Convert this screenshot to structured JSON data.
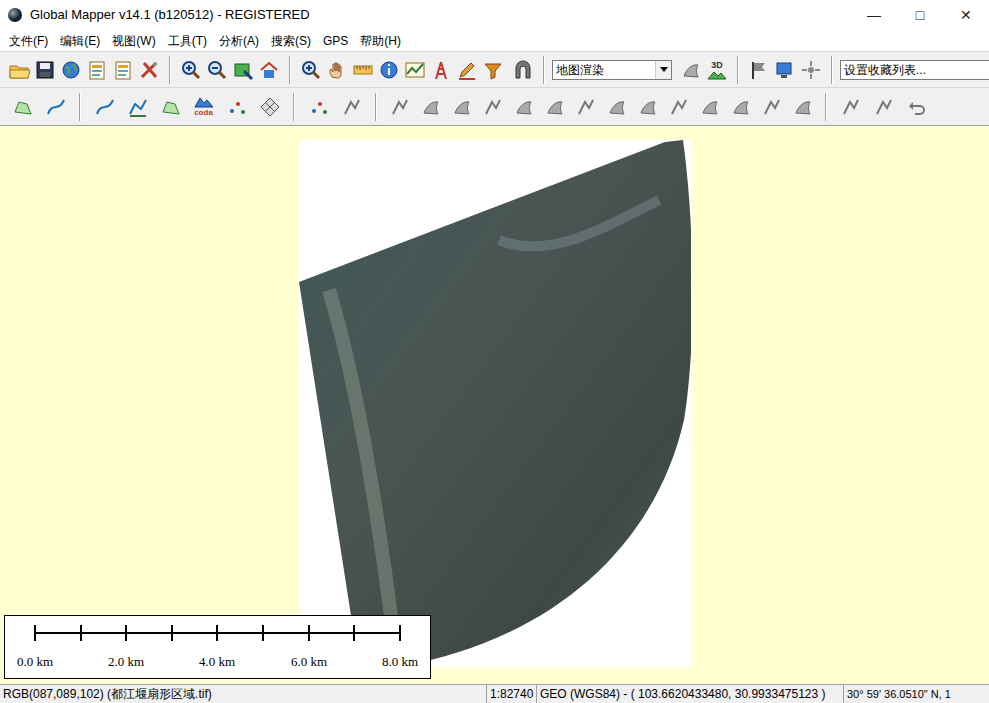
{
  "window": {
    "title": "Global Mapper v14.1 (b120512) - REGISTERED",
    "controls": [
      "—",
      "□",
      "✕"
    ]
  },
  "menu": [
    "文件(F)",
    "编辑(E)",
    "视图(W)",
    "工具(T)",
    "分析(A)",
    "搜索(S)",
    "GPS",
    "帮助(H)"
  ],
  "toolbar": {
    "render_mode": "地图渲染",
    "favorites": "设置收藏列表...",
    "button_3d": "3D",
    "coda_icon": "coda"
  },
  "scale_bar": {
    "labels": [
      "0.0 km",
      "2.0 km",
      "4.0 km",
      "6.0 km",
      "8.0 km"
    ]
  },
  "status_bar": {
    "pixel": "RGB(087,089,102) (都江堰扇形区域.tif)",
    "scale": "1:82740",
    "coords": "GEO (WGS84) - ( 103.6620433480, 30.9933475123 )",
    "dms": "30° 59' 36.0510\" N, 1"
  }
}
